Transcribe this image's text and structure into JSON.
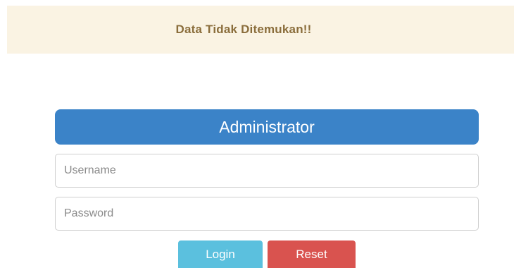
{
  "alert": {
    "message": "Data Tidak Ditemukan!!"
  },
  "login_panel": {
    "title": "Administrator",
    "username": {
      "placeholder": "Username",
      "value": ""
    },
    "password": {
      "placeholder": "Password",
      "value": ""
    },
    "login_label": "Login",
    "reset_label": "Reset"
  },
  "colors": {
    "alert_background": "#faf3e3",
    "alert_text": "#8a6d3b",
    "header": "#3b83c8",
    "login_button": "#5bc0de",
    "reset_button": "#d9534f"
  }
}
